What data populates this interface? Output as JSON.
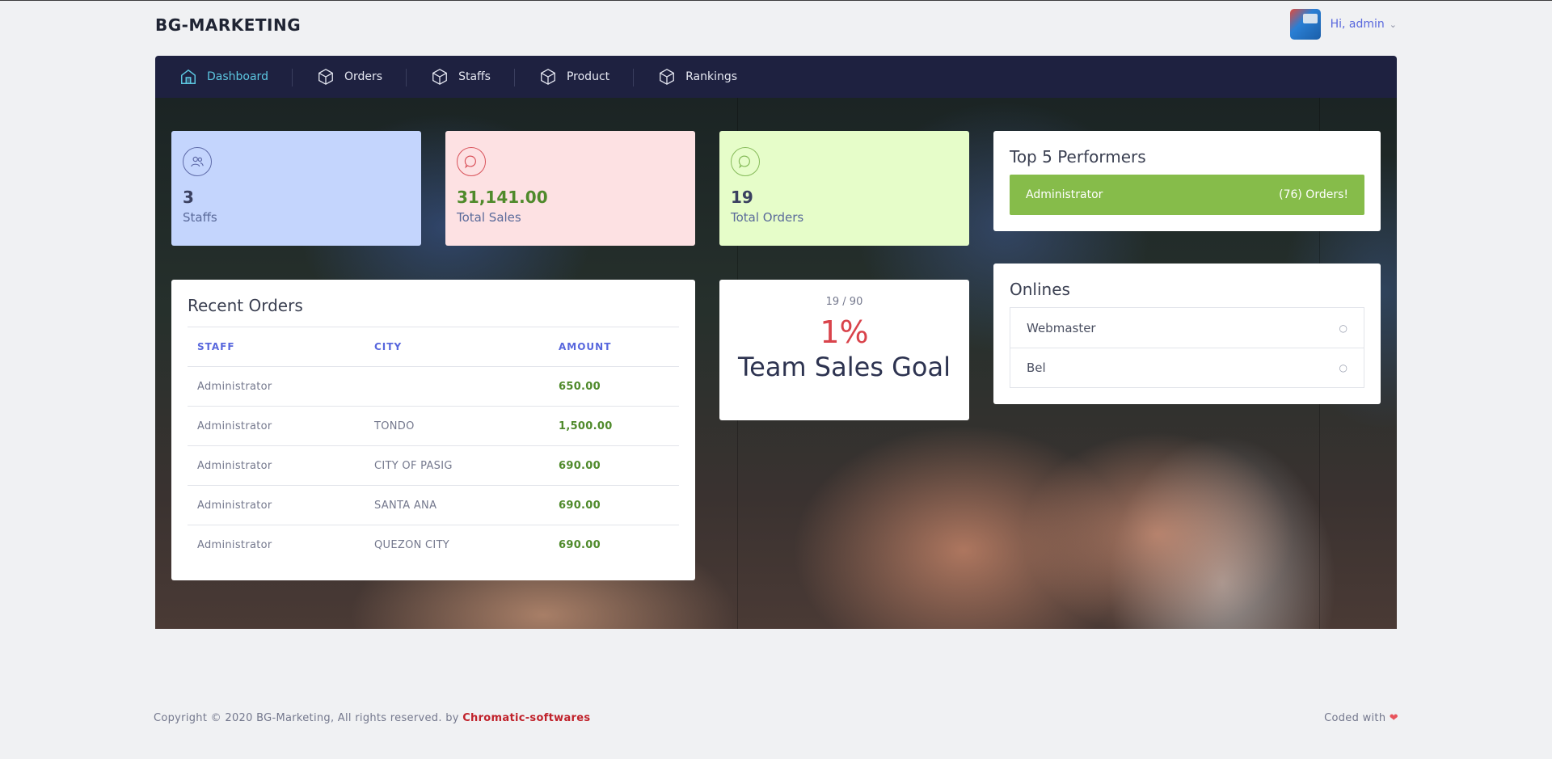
{
  "header": {
    "brand": "BG-MARKETING",
    "greeting": "Hi, admin"
  },
  "nav": {
    "items": [
      {
        "label": "Dashboard",
        "icon": "home-icon"
      },
      {
        "label": "Orders",
        "icon": "cube-icon"
      },
      {
        "label": "Staffs",
        "icon": "cube-icon"
      },
      {
        "label": "Product",
        "icon": "cube-icon"
      },
      {
        "label": "Rankings",
        "icon": "cube-icon"
      }
    ],
    "active": "Dashboard"
  },
  "stats": {
    "staffs": {
      "value": "3",
      "label": "Staffs",
      "icon": "users-icon"
    },
    "sales": {
      "value": "31,141.00",
      "label": "Total Sales",
      "icon": "chat-bubble-icon"
    },
    "orders": {
      "value": "19",
      "label": "Total Orders",
      "icon": "chat-bubble-icon"
    }
  },
  "top_performers": {
    "title": "Top 5 Performers",
    "items": [
      {
        "name": "Administrator",
        "orders": "(76) Orders!"
      }
    ]
  },
  "onlines": {
    "title": "Onlines",
    "items": [
      {
        "name": "Webmaster",
        "status": "○"
      },
      {
        "name": "Bel",
        "status": "○"
      }
    ]
  },
  "recent_orders": {
    "title": "Recent Orders",
    "columns": [
      "STAFF",
      "CITY",
      "AMOUNT"
    ],
    "rows": [
      {
        "staff": "Administrator",
        "city": "",
        "amount": "650.00"
      },
      {
        "staff": "Administrator",
        "city": "TONDO",
        "amount": "1,500.00"
      },
      {
        "staff": "Administrator",
        "city": "CITY OF PASIG",
        "amount": "690.00"
      },
      {
        "staff": "Administrator",
        "city": "SANTA ANA",
        "amount": "690.00"
      },
      {
        "staff": "Administrator",
        "city": "QUEZON CITY",
        "amount": "690.00"
      }
    ]
  },
  "goal": {
    "ratio": "19 / 90",
    "percent": "1%",
    "label": "Team Sales Goal"
  },
  "footer": {
    "copyright": "Copyright © 2020 BG-Marketing, All rights reserved. by",
    "link": "Chromatic-softwares",
    "coded_with": "Coded with"
  },
  "colors": {
    "navbar": "#1e2140",
    "accent": "#5867dd",
    "active_nav": "#5cc6e0",
    "top_performer_bar": "#86bc4a",
    "goal_percent": "#d9434b",
    "footer_link": "#c0222b"
  }
}
